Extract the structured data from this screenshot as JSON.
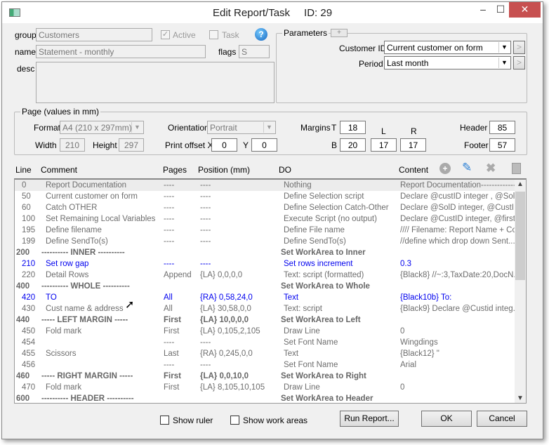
{
  "window": {
    "title": "Edit Report/Task",
    "id_label": "ID: 29",
    "minimize": "–",
    "maximize": "☐",
    "close": "✕"
  },
  "form": {
    "group_label": "group",
    "group_value": "Customers",
    "active_label": "Active",
    "active_checked": true,
    "task_label": "Task",
    "task_checked": false,
    "help": "?",
    "name_label": "name",
    "name_value": "Statement - monthly",
    "flags_label": "flags",
    "flags_value": "S",
    "desc_label": "desc",
    "desc_value": ""
  },
  "parameters": {
    "label": "Parameters",
    "add": "+",
    "items": [
      {
        "label": "Customer ID",
        "value": "Current customer on form"
      },
      {
        "label": "Period",
        "value": "Last month"
      }
    ],
    "go": ">"
  },
  "page": {
    "label": "Page (values in mm)",
    "format_label": "Format",
    "format_value": "A4 (210 x 297mm)",
    "orientation_label": "Orientation",
    "orientation_value": "Portrait",
    "width_label": "Width",
    "width_value": "210",
    "height_label": "Height",
    "height_value": "297",
    "offset_label": "Print offset X",
    "offset_x": "0",
    "y_label": "Y",
    "offset_y": "0",
    "margins_label": "Margins",
    "t_label": "T",
    "t": "18",
    "b_label": "B",
    "b": "20",
    "l_label": "L",
    "l": "17",
    "r_label": "R",
    "r": "17",
    "header_label": "Header",
    "header": "85",
    "footer_label": "Footer",
    "footer": "57"
  },
  "table": {
    "headers": {
      "line": "Line",
      "comment": "Comment",
      "pages": "Pages",
      "position": "Position (mm)",
      "do": "DO",
      "content": "Content"
    },
    "rows": [
      {
        "line": "0",
        "comment": "Report Documentation",
        "pages": "----",
        "position": "----",
        "do": "Nothing",
        "content": "Report Documentation-------------...",
        "style": "sel"
      },
      {
        "line": "50",
        "comment": "Current customer on form",
        "pages": "----",
        "position": "----",
        "do": "Define Selection script",
        "content": "Declare @custID integer , @Sol...",
        "style": ""
      },
      {
        "line": "60",
        "comment": "Catch OTHER",
        "pages": "----",
        "position": "----",
        "do": "Define Selection Catch-Other",
        "content": "Declare @SolD integer, @CustI...",
        "style": ""
      },
      {
        "line": "100",
        "comment": "Set Remaining Local Variables",
        "pages": "----",
        "position": "----",
        "do": "Execute Script (no output)",
        "content": "Declare @CustID integer, @first...",
        "style": ""
      },
      {
        "line": "195",
        "comment": "Define filename",
        "pages": "----",
        "position": "----",
        "do": "Define File name",
        "content": "//// Filename: Report Name + Co...",
        "style": ""
      },
      {
        "line": "199",
        "comment": "Define SendTo(s)",
        "pages": "----",
        "position": "----",
        "do": "Define SendTo(s)",
        "content": "//define which drop down Sent...",
        "style": ""
      },
      {
        "line": "200",
        "comment": "---------- INNER ----------",
        "pages": "",
        "position": "",
        "do": "Set WorkArea to Inner",
        "content": "",
        "style": "b"
      },
      {
        "line": "210",
        "comment": "Set row gap",
        "pages": "----",
        "position": "----",
        "do": "Set rows increment",
        "content": "0.3",
        "style": "u"
      },
      {
        "line": "220",
        "comment": "Detail Rows",
        "pages": "Append",
        "position": "{LA} 0,0,0,0",
        "do": "Text: script (formatted)",
        "content": "{Black8}  //~:3,TaxDate:20,DocN...",
        "style": ""
      },
      {
        "line": "400",
        "comment": "---------- WHOLE ----------",
        "pages": "",
        "position": "",
        "do": "Set WorkArea to Whole",
        "content": "",
        "style": "b"
      },
      {
        "line": "420",
        "comment": "TO",
        "pages": "All",
        "position": "{RA} 0,58,24,0",
        "do": "Text",
        "content": "{Black10b}  To:",
        "style": "u"
      },
      {
        "line": "430",
        "comment": "Cust name & address",
        "pages": "All",
        "position": "{LA} 30,58,0,0",
        "do": "Text: script",
        "content": "{Black9}  Declare @Custid integ...",
        "style": ""
      },
      {
        "line": "440",
        "comment": "----- LEFT MARGIN -----",
        "pages": "First",
        "position": "{LA} 10,0,0,0",
        "do": "Set WorkArea to Left",
        "content": "",
        "style": "b"
      },
      {
        "line": "450",
        "comment": "Fold mark",
        "pages": "First",
        "position": "{LA} 0,105,2,105",
        "do": "Draw Line",
        "content": "0",
        "style": ""
      },
      {
        "line": "454",
        "comment": "",
        "pages": "----",
        "position": "----",
        "do": "Set Font Name",
        "content": "Wingdings",
        "style": ""
      },
      {
        "line": "455",
        "comment": "Scissors",
        "pages": "Last",
        "position": "{RA} 0,245,0,0",
        "do": "Text",
        "content": "{Black12}  \"",
        "style": ""
      },
      {
        "line": "456",
        "comment": "",
        "pages": "----",
        "position": "----",
        "do": "Set Font Name",
        "content": "Arial",
        "style": ""
      },
      {
        "line": "460",
        "comment": "----- RIGHT MARGIN -----",
        "pages": "First",
        "position": "{LA} 0,0,10,0",
        "do": "Set WorkArea to Right",
        "content": "",
        "style": "b"
      },
      {
        "line": "470",
        "comment": "Fold mark",
        "pages": "First",
        "position": "{LA} 8,105,10,105",
        "do": "Draw Line",
        "content": "0",
        "style": ""
      },
      {
        "line": "600",
        "comment": "---------- HEADER ----------",
        "pages": "",
        "position": "",
        "do": "Set WorkArea to Header",
        "content": "",
        "style": "b"
      }
    ]
  },
  "footer": {
    "show_ruler": "Show ruler",
    "show_work_areas": "Show work areas",
    "run_report": "Run Report...",
    "ok": "OK",
    "cancel": "Cancel"
  }
}
